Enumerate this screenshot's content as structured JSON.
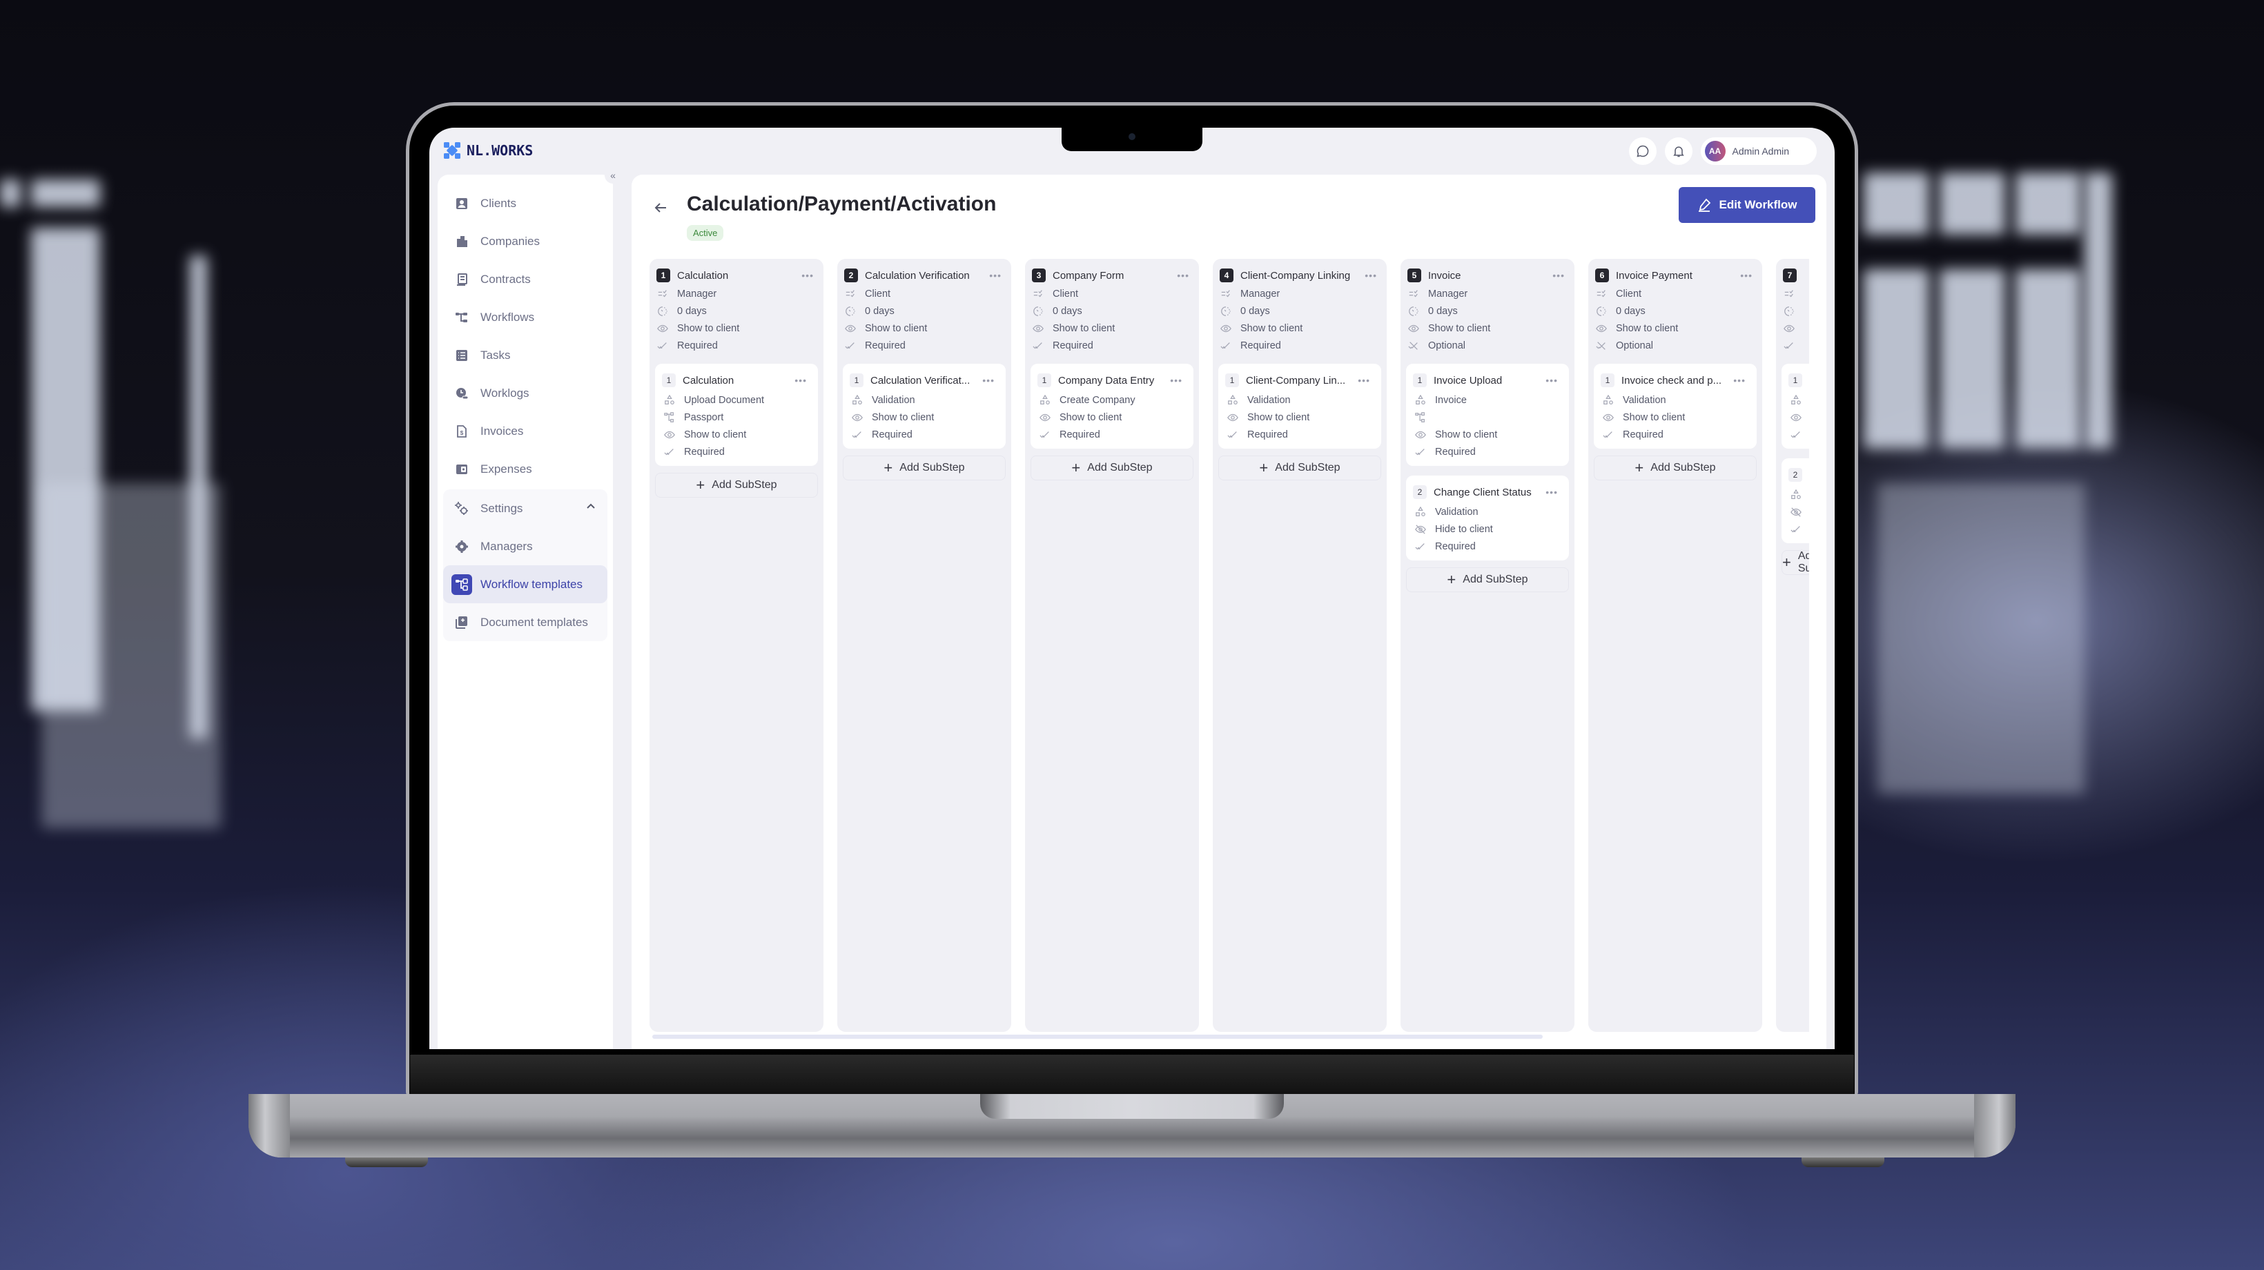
{
  "app": {
    "brand": "NL.WORKS",
    "brand_color": "#1b1f5e",
    "accent": "#4450b8",
    "logo_color": "#4b8cf5"
  },
  "topbar": {
    "chat_icon": "chat-bubble-icon",
    "notification_icon": "bell-icon",
    "user": {
      "initials": "AA",
      "name": "Admin Admin"
    }
  },
  "sidebar": {
    "collapse_label": "«",
    "items": [
      {
        "label": "Clients",
        "icon": "person-card-icon"
      },
      {
        "label": "Companies",
        "icon": "buildings-icon"
      },
      {
        "label": "Contracts",
        "icon": "document-icon"
      },
      {
        "label": "Workflows",
        "icon": "workflow-icon"
      },
      {
        "label": "Tasks",
        "icon": "task-list-icon"
      },
      {
        "label": "Worklogs",
        "icon": "clock-person-icon"
      },
      {
        "label": "Invoices",
        "icon": "invoice-dollar-icon"
      },
      {
        "label": "Expenses",
        "icon": "wallet-icon"
      }
    ],
    "settings": {
      "label": "Settings",
      "expanded": true,
      "children": [
        {
          "label": "Managers",
          "icon": "managers-icon",
          "active": false
        },
        {
          "label": "Workflow templates",
          "icon": "workflow-template-icon",
          "active": true
        },
        {
          "label": "Document templates",
          "icon": "document-template-icon",
          "active": false
        }
      ]
    }
  },
  "page": {
    "title": "Calculation/Payment/Activation",
    "status": "Active",
    "edit_button": "Edit Workflow",
    "add_substep_label": "Add SubStep"
  },
  "steps": [
    {
      "num": "1",
      "title": "Calculation",
      "assignee": "Manager",
      "duration": "0 days",
      "visibility": "Show to client",
      "requirement": "Required",
      "substeps": [
        {
          "num": "1",
          "title": "Calculation",
          "type": "Upload Document",
          "document": "Passport",
          "visibility": "Show to client",
          "requirement": "Required"
        }
      ]
    },
    {
      "num": "2",
      "title": "Calculation Verification",
      "assignee": "Client",
      "duration": "0 days",
      "visibility": "Show to client",
      "requirement": "Required",
      "substeps": [
        {
          "num": "1",
          "title": "Calculation Verificat...",
          "type": "Validation",
          "visibility": "Show to client",
          "requirement": "Required"
        }
      ]
    },
    {
      "num": "3",
      "title": "Company Form",
      "assignee": "Client",
      "duration": "0 days",
      "visibility": "Show to client",
      "requirement": "Required",
      "substeps": [
        {
          "num": "1",
          "title": "Company Data Entry",
          "type": "Create Company",
          "visibility": "Show to client",
          "requirement": "Required"
        }
      ]
    },
    {
      "num": "4",
      "title": "Client-Company Linking",
      "assignee": "Manager",
      "duration": "0 days",
      "visibility": "Show to client",
      "requirement": "Required",
      "substeps": [
        {
          "num": "1",
          "title": "Client-Company Lin...",
          "type": "Validation",
          "visibility": "Show to client",
          "requirement": "Required"
        }
      ]
    },
    {
      "num": "5",
      "title": "Invoice",
      "assignee": "Manager",
      "duration": "0 days",
      "visibility": "Show to client",
      "requirement": "Optional",
      "substeps": [
        {
          "num": "1",
          "title": "Invoice Upload",
          "type": "Invoice",
          "document": "",
          "visibility": "Show to client",
          "requirement": "Required"
        },
        {
          "num": "2",
          "title": "Change Client Status",
          "type": "Validation",
          "visibility": "Hide to client",
          "requirement": "Required"
        }
      ]
    },
    {
      "num": "6",
      "title": "Invoice Payment",
      "assignee": "Client",
      "duration": "0 days",
      "visibility": "Show to client",
      "requirement": "Optional",
      "substeps": [
        {
          "num": "1",
          "title": "Invoice check and p...",
          "type": "Validation",
          "visibility": "Show to client",
          "requirement": "Required"
        }
      ]
    },
    {
      "num": "7",
      "title": "",
      "assignee": "",
      "duration": "",
      "visibility": "",
      "requirement": "",
      "substeps": [
        {
          "num": "1",
          "title": "",
          "type": "",
          "visibility": "",
          "requirement": ""
        },
        {
          "num": "2",
          "title": "",
          "type": "",
          "visibility": "",
          "requirement": ""
        }
      ]
    }
  ]
}
